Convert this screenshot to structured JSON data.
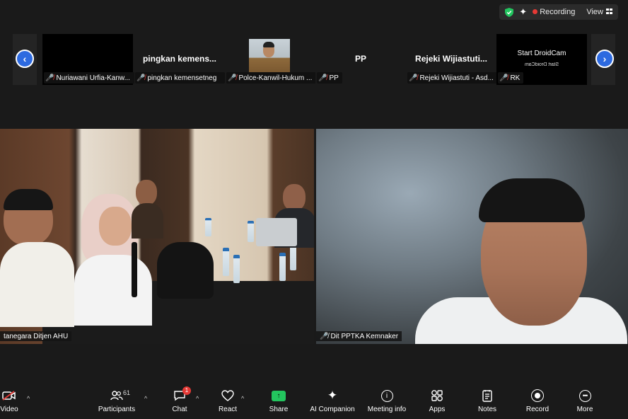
{
  "topbar": {
    "recording_label": "Recording",
    "view_label": "View",
    "colors": {
      "recording_dot": "#e53935",
      "shield": "#22c55e"
    }
  },
  "gallery": {
    "tiles": [
      {
        "name": "",
        "label": "Nuriawani Urfia-Kanw..."
      },
      {
        "name": "pingkan  kemens...",
        "label": "pingkan kemensetneg"
      },
      {
        "name": "",
        "label": "Polce-Kanwil-Hukum ..."
      },
      {
        "name": "PP",
        "label": "PP"
      },
      {
        "name": "Rejeki  Wijiastuti...",
        "label": "Rejeki Wijiastuti - Asd..."
      },
      {
        "name": "",
        "label": "RK",
        "overlay_line1": "Start DroidCam",
        "overlay_line2": "Start DroidCam"
      }
    ]
  },
  "main": {
    "left_label": "tanegara Ditjen AHU",
    "right_label": "Dit PPTKA Kemnaker"
  },
  "toolbar": {
    "video": "Video",
    "participants": "Participants",
    "participants_count": "61",
    "chat": "Chat",
    "chat_badge": "1",
    "react": "React",
    "share": "Share",
    "ai_companion": "AI Companion",
    "meeting_info": "Meeting info",
    "apps": "Apps",
    "notes": "Notes",
    "record": "Record",
    "more": "More",
    "colors": {
      "share": "#23c55e",
      "badge": "#e53935"
    }
  }
}
